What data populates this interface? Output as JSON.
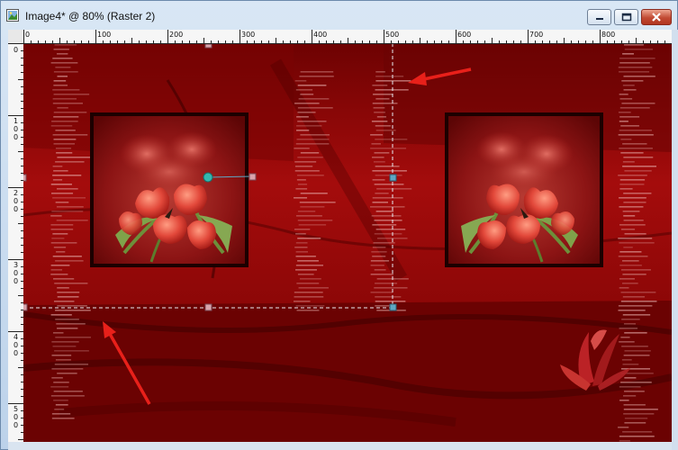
{
  "window": {
    "title": "Image4* @  80% (Raster 2)",
    "buttons": {
      "minimize": "minimize-icon",
      "maximize": "maximize-icon",
      "close": "close-icon"
    }
  },
  "ruler": {
    "horizontal_labels": [
      "0",
      "100",
      "200",
      "300",
      "400",
      "500",
      "600",
      "700",
      "800"
    ],
    "vertical_labels": [
      "0",
      "1\n0\n0",
      "2\n0\n0",
      "3\n0\n0",
      "4\n0\n0",
      "5\n0\n0"
    ]
  },
  "canvas": {
    "background": "#8a0606",
    "frames": [
      "left-tulip-frame",
      "right-tulip-frame"
    ],
    "selection": "dashed selection rectangle with handles",
    "arrows": [
      "top-arrow",
      "bottom-arrow"
    ],
    "arrow_color": "#e8201a"
  }
}
